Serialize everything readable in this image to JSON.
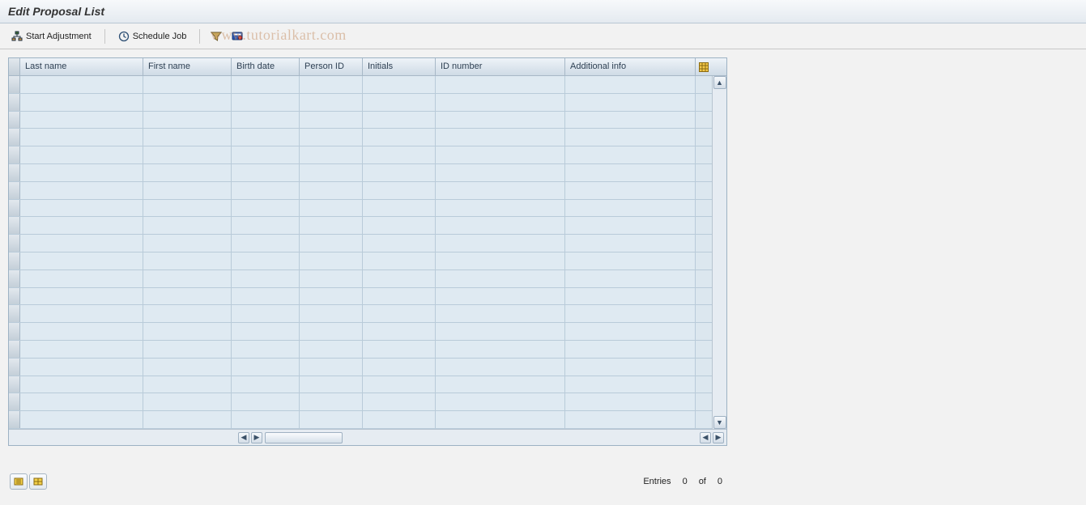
{
  "header": {
    "title": "Edit Proposal List"
  },
  "toolbar": {
    "start_adjustment": "Start Adjustment",
    "schedule_job": "Schedule Job"
  },
  "watermark": "www.tutorialkart.com",
  "grid": {
    "columns": {
      "last_name": "Last name",
      "first_name": "First name",
      "birth_date": "Birth date",
      "person_id": "Person ID",
      "initials": "Initials",
      "id_number": "ID number",
      "additional_info": "Additional info"
    },
    "rows": [
      {},
      {},
      {},
      {},
      {},
      {},
      {},
      {},
      {},
      {},
      {},
      {},
      {},
      {},
      {},
      {},
      {},
      {},
      {},
      {}
    ]
  },
  "footer": {
    "entries_label": "Entries",
    "count": "0",
    "of_label": "of",
    "total": "0"
  }
}
